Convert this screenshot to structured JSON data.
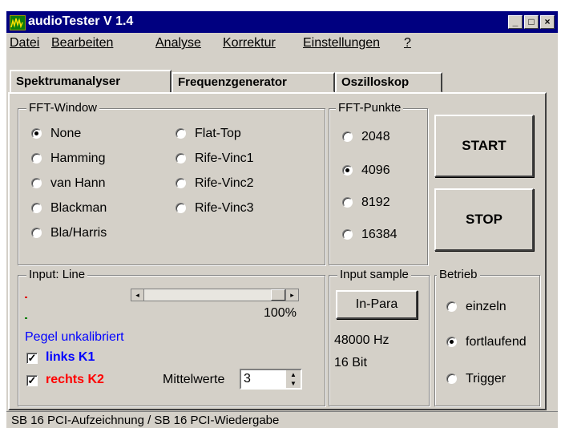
{
  "window": {
    "title": "audioTester V 1.4",
    "title_bar_color": "#000080",
    "controls": [
      "minimize-icon",
      "maximize-icon",
      "close-icon"
    ]
  },
  "menu": [
    "Datei",
    "Bearbeiten",
    "Analyse",
    "Korrektur",
    "Einstellungen",
    "?"
  ],
  "tabs": [
    {
      "label": "Spektrumanalyser",
      "active": true
    },
    {
      "label": "Frequenzgenerator",
      "active": false
    },
    {
      "label": "Oszilloskop",
      "active": false
    }
  ],
  "fft_window": {
    "legend": "FFT-Window",
    "options": [
      "None",
      "Hamming",
      "van Hann",
      "Blackman",
      "Bla/Harris",
      "Flat-Top",
      "Rife-Vinc1",
      "Rife-Vinc2",
      "Rife-Vinc3"
    ],
    "selected": "None"
  },
  "fft_points": {
    "legend": "FFT-Punkte",
    "options": [
      "2048",
      "4096",
      "8192",
      "16384"
    ],
    "selected": "4096"
  },
  "buttons": {
    "start": "START",
    "stop": "STOP",
    "in_para": "In-Para"
  },
  "input_line": {
    "legend": "Input: Line",
    "level_percent": "100%",
    "level_fraction": 1.0,
    "pegel_text": "Pegel unkalibriert",
    "pegel_color": "#0000ff",
    "left_channel": "links K1",
    "left_color": "#0000ff",
    "right_channel": "rechts K2",
    "right_color": "#ff0000",
    "averages_label": "Mittelwerte",
    "averages_value": "3"
  },
  "input_sample": {
    "legend": "Input sample",
    "rate": "48000 Hz",
    "bits": "16 Bit"
  },
  "betrieb": {
    "legend": "Betrieb",
    "options": [
      "einzeln",
      "fortlaufend",
      "Trigger"
    ],
    "selected": "fortlaufend"
  },
  "status": "SB 16 PCI-Aufzeichnung / SB 16 PCI-Wiedergabe"
}
